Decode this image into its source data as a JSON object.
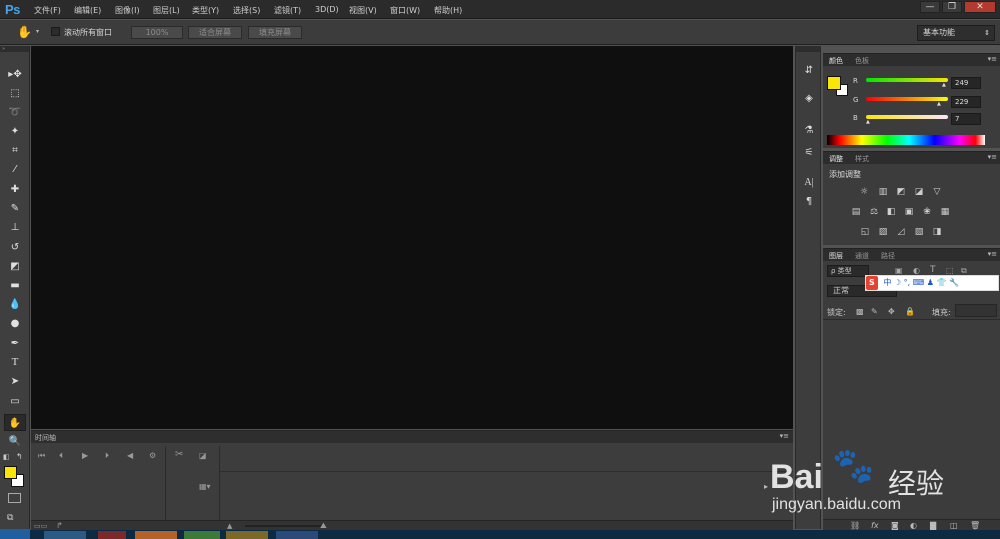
{
  "app": {
    "logo": "Ps"
  },
  "menu": [
    "文件(F)",
    "编辑(E)",
    "图像(I)",
    "图层(L)",
    "类型(Y)",
    "选择(S)",
    "滤镜(T)",
    "3D(D)",
    "视图(V)",
    "窗口(W)",
    "帮助(H)"
  ],
  "window_controls": {
    "minimize": "—",
    "restore": "❐",
    "close": "✕"
  },
  "options": {
    "hand_icon": "hand-icon",
    "scroll_all_label": "滚动所有窗口",
    "zoom_100": "100%",
    "fit_screen": "适合屏幕",
    "fill_screen": "填充屏幕",
    "workspace": "基本功能"
  },
  "tools": [
    "move-tool",
    "marquee-tool",
    "lasso-tool",
    "quick-select-tool",
    "crop-tool",
    "eyedropper-tool",
    "healing-brush-tool",
    "brush-tool",
    "clone-stamp-tool",
    "history-brush-tool",
    "eraser-tool",
    "gradient-tool",
    "blur-tool",
    "dodge-tool",
    "pen-tool",
    "type-tool",
    "path-select-tool",
    "rectangle-tool",
    "hand-tool",
    "zoom-tool"
  ],
  "colors": {
    "foreground": "#f9e507",
    "background": "#ffffff",
    "canvas": "#0f0f0f"
  },
  "timeline": {
    "tab": "时间轴"
  },
  "color_panel": {
    "tabs": [
      "颜色",
      "色板"
    ],
    "r_label": "R",
    "g_label": "G",
    "b_label": "B",
    "r": "249",
    "g": "229",
    "b": "7"
  },
  "adjust_panel": {
    "tabs": [
      "调整",
      "样式"
    ],
    "title": "添加调整"
  },
  "layers_panel": {
    "tabs": [
      "图层",
      "通道",
      "路径"
    ],
    "kind_filter": "ρ 类型",
    "blend_mode": "正常",
    "lock_label": "锁定:",
    "fill_label": "填充:"
  },
  "ime_bar": {
    "label": "中"
  },
  "watermark": {
    "line1": "Bai",
    "line2": "经验",
    "url": "jingyan.baidu.com"
  }
}
